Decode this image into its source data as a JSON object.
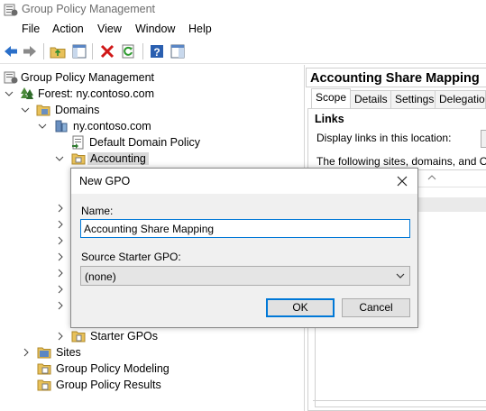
{
  "window": {
    "title": "Group Policy Management"
  },
  "menu": [
    "File",
    "Action",
    "View",
    "Window",
    "Help"
  ],
  "toolbar": {
    "icons": [
      "back-arrow-icon",
      "forward-arrow-icon",
      "up-folder-icon",
      "show-hide-tree-icon",
      "delete-icon",
      "refresh-icon",
      "help-icon",
      "properties-icon"
    ]
  },
  "tree": {
    "root": "Group Policy Management",
    "forest": "Forest: ny.contoso.com",
    "domains": "Domains",
    "domain": "ny.contoso.com",
    "default_policy": "Default Domain Policy",
    "accounting": "Accounting",
    "starter_gpos": "Starter GPOs",
    "sites": "Sites",
    "modeling": "Group Policy Modeling",
    "results": "Group Policy Results"
  },
  "right_pane": {
    "title": "Accounting Share Mapping",
    "tabs": [
      "Scope",
      "Details",
      "Settings",
      "Delegation"
    ],
    "active_tab": "Scope",
    "links_heading": "Links",
    "display_links_label": "Display links in this location:",
    "following_text": "The following sites, domains, and OUs a"
  },
  "dialog": {
    "title": "New GPO",
    "name_label": "Name:",
    "name_value": "Accounting Share Mapping",
    "starter_label": "Source Starter GPO:",
    "starter_value": "(none)",
    "ok": "OK",
    "cancel": "Cancel"
  },
  "colors": {
    "accent": "#0078d7",
    "folder": "#e8c15a",
    "selection": "#d9d9d9"
  }
}
